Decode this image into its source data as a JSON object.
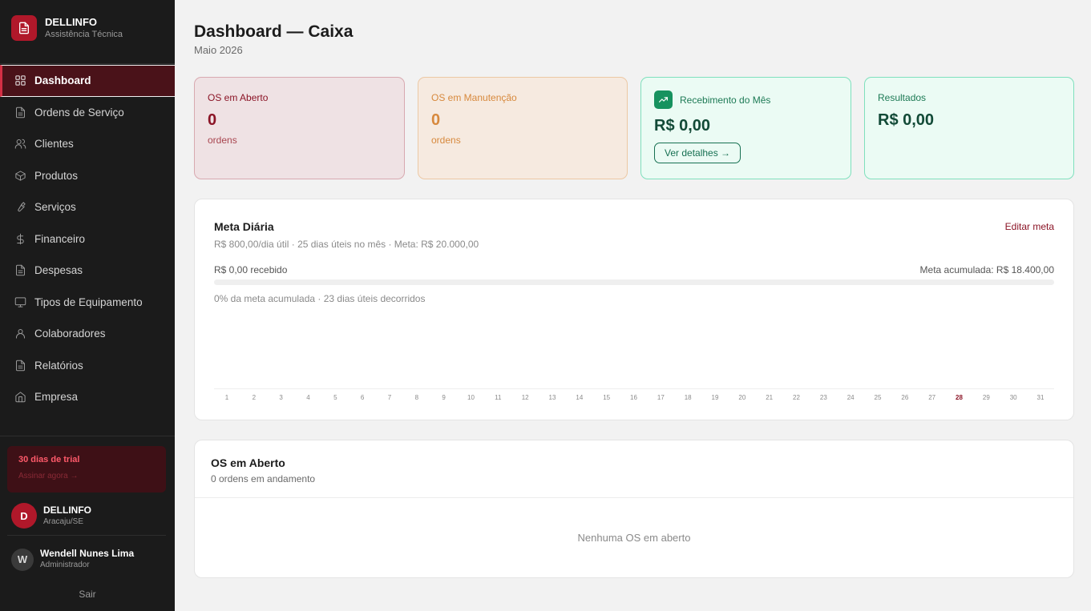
{
  "brand": {
    "name": "DELLINFO",
    "subtitle": "Assistência Técnica"
  },
  "nav": {
    "items": [
      {
        "label": "Dashboard",
        "icon": "dashboard-grid-icon",
        "active": true
      },
      {
        "label": "Ordens de Serviço",
        "icon": "document-icon"
      },
      {
        "label": "Clientes",
        "icon": "users-icon"
      },
      {
        "label": "Produtos",
        "icon": "box-icon"
      },
      {
        "label": "Serviços",
        "icon": "wrench-icon"
      },
      {
        "label": "Financeiro",
        "icon": "dollar-icon"
      },
      {
        "label": "Despesas",
        "icon": "document-icon"
      },
      {
        "label": "Tipos de Equipamento",
        "icon": "monitor-icon"
      },
      {
        "label": "Colaboradores",
        "icon": "user-icon"
      },
      {
        "label": "Relatórios",
        "icon": "document-icon"
      },
      {
        "label": "Empresa",
        "icon": "home-icon"
      }
    ]
  },
  "trial": {
    "title": "30 dias de trial",
    "link": "Assinar agora →"
  },
  "company": {
    "initial": "D",
    "name": "DELLINFO",
    "location": "Aracaju/SE"
  },
  "user": {
    "initial": "W",
    "name": "Wendell Nunes Lima",
    "role": "Administrador"
  },
  "logout_label": "Sair",
  "header": {
    "title": "Dashboard — Caixa",
    "subtitle": "Maio 2026"
  },
  "cards": {
    "open": {
      "label": "OS em Aberto",
      "value": "0",
      "unit": "ordens"
    },
    "maintenance": {
      "label": "OS em Manutenção",
      "value": "0",
      "unit": "ordens"
    },
    "received": {
      "label": "Recebimento do Mês",
      "value": "R$ 0,00",
      "button": "Ver detalhes →"
    },
    "results": {
      "label": "Resultados",
      "value": "R$ 0,00"
    }
  },
  "meta": {
    "title": "Meta Diária",
    "subtitle": "R$ 800,00/dia útil · 25 dias úteis no mês · Meta: R$ 20.000,00",
    "edit_label": "Editar meta",
    "received": "R$ 0,00 recebido",
    "accumulated": "Meta acumulada: R$ 18.400,00",
    "progress_percent": 0,
    "note": "0% da meta acumulada · 23 dias úteis decorridos",
    "days": [
      "1",
      "2",
      "3",
      "4",
      "5",
      "6",
      "7",
      "8",
      "9",
      "10",
      "11",
      "12",
      "13",
      "14",
      "15",
      "16",
      "17",
      "18",
      "19",
      "20",
      "21",
      "22",
      "23",
      "24",
      "25",
      "26",
      "27",
      "28",
      "29",
      "30",
      "31"
    ],
    "today": "28"
  },
  "os_open": {
    "title": "OS em Aberto",
    "subtitle": "0 ordens em andamento",
    "empty": "Nenhuma OS em aberto"
  },
  "colors": {
    "accent": "#b0182a",
    "sidebar_bg": "#1b1b1b",
    "success": "#17925f",
    "warning": "#d7893d"
  }
}
